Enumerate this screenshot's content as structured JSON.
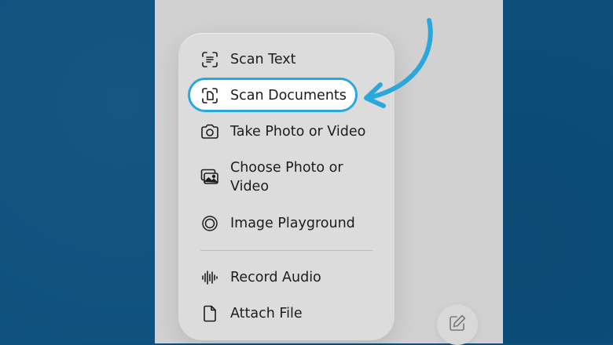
{
  "colors": {
    "background": "#0d4f7d",
    "screen": "#d1d1d1",
    "menu": "#dcdcdc",
    "highlight_border": "#2aa7dd",
    "arrow": "#2aa7dd",
    "text": "#1c1c1e"
  },
  "menu": {
    "items": [
      {
        "label": "Scan Text",
        "icon": "scan-text-icon"
      },
      {
        "label": "Scan Documents",
        "icon": "scan-documents-icon",
        "highlighted": true
      },
      {
        "label": "Take Photo or Video",
        "icon": "camera-icon"
      },
      {
        "label": "Choose Photo or Video",
        "icon": "photo-library-icon"
      },
      {
        "label": "Image Playground",
        "icon": "image-playground-icon"
      },
      {
        "label": "Record Audio",
        "icon": "waveform-icon"
      },
      {
        "label": "Attach File",
        "icon": "document-icon"
      }
    ]
  },
  "compose_button": {
    "icon": "compose-icon"
  },
  "annotation": {
    "icon": "curved-arrow-icon"
  }
}
